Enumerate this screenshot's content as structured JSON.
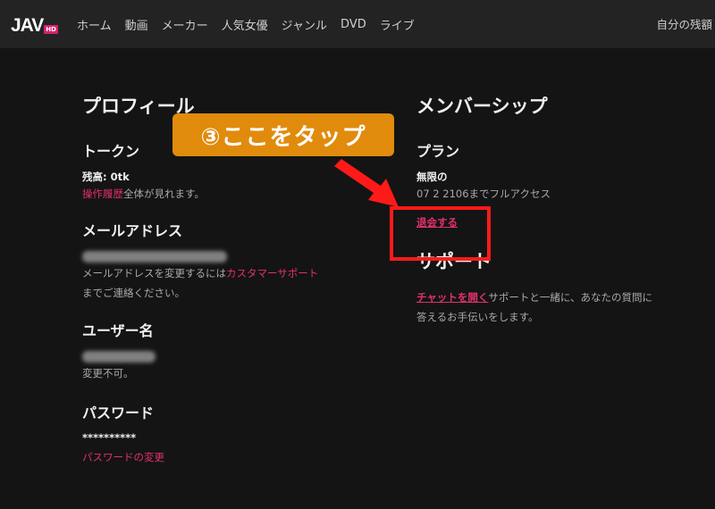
{
  "header": {
    "logo_text": "JAV",
    "logo_badge": "HD",
    "nav": [
      "ホーム",
      "動画",
      "メーカー",
      "人気女優",
      "ジャンル",
      "DVD",
      "ライブ"
    ],
    "right_text": "自分の残額"
  },
  "profile": {
    "title": "プロフィール",
    "token": {
      "heading": "トークン",
      "balance": "残高: 0tk",
      "history_link": "操作履歴",
      "history_suffix": "全体が見れます。"
    },
    "email": {
      "heading": "メールアドレス",
      "note_prefix": "メールアドレスを変更するには",
      "support_link": "カスタマーサポート",
      "note_suffix": "までご連絡ください。"
    },
    "username": {
      "heading": "ユーザー名",
      "note": "変更不可。"
    },
    "password": {
      "heading": "パスワード",
      "masked": "**********",
      "change_link": "パスワードの変更"
    }
  },
  "membership": {
    "title": "メンバーシップ",
    "plan_heading": "プラン",
    "plan_name": "無限の",
    "plan_note": "07 2 2106までフルアクセス",
    "cancel_link": "退会する"
  },
  "support": {
    "title": "サポート",
    "chat_link": "チャットを開く",
    "text_line1": "サポートと一緒に、あなたの質問に",
    "text_line2": "答えるお手伝いをします。"
  },
  "annotation": {
    "callout": "③ここをタップ",
    "callout_color": "#e18b0c",
    "highlight_color": "#ff1a1a"
  },
  "colors": {
    "accent": "#e0306e",
    "background": "#141414",
    "header_bg": "#232323"
  }
}
